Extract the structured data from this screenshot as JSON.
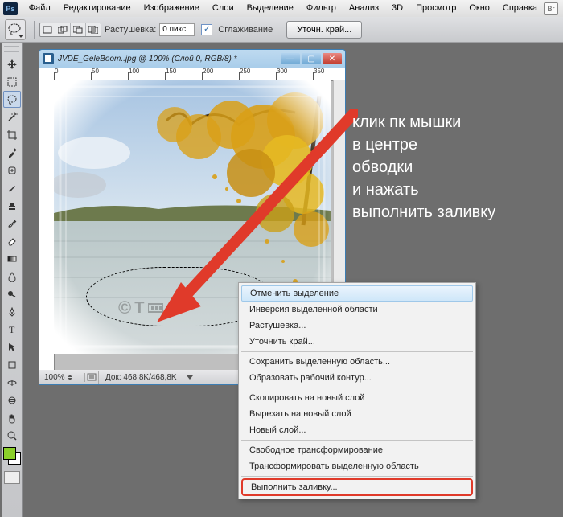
{
  "menu": {
    "items": [
      "Файл",
      "Редактирование",
      "Изображение",
      "Слои",
      "Выделение",
      "Фильтр",
      "Анализ",
      "3D",
      "Просмотр",
      "Окно",
      "Справка"
    ],
    "launch": "Br"
  },
  "options": {
    "feather_label": "Растушевка:",
    "feather_value": "0 пикс.",
    "aa_label": "Сглаживание",
    "refine_btn": "Уточн. край..."
  },
  "doc": {
    "title": "JVDE_GeleBoom..jpg @ 100% (Слой 0, RGB/8) *",
    "ruler_ticks": [
      "0",
      "50",
      "100",
      "150",
      "200",
      "250",
      "300",
      "350"
    ],
    "status_zoom": "100%",
    "status_doc": "Док: 468,8K/468,8K",
    "watermark": "© T"
  },
  "context_menu": {
    "items": [
      "Отменить выделение",
      "Инверсия выделенной области",
      "Растушевка...",
      "Уточнить край...",
      "—",
      "Сохранить выделенную область...",
      "Образовать рабочий контур...",
      "—",
      "Скопировать на новый слой",
      "Вырезать на новый слой",
      "Новый слой...",
      "—",
      "Свободное трансформирование",
      "Трансформировать выделенную область",
      "—",
      "Выполнить заливку..."
    ],
    "highlighted_index": 0,
    "outlined_index": 15
  },
  "annotation": {
    "l1": "клик пк мышки",
    "l2": "в центре",
    "l3": "обводки",
    "l4": "и нажать",
    "l5": "выполнить заливку"
  },
  "tool_names": [
    "move",
    "marquee",
    "lasso",
    "wand",
    "crop",
    "eyedropper",
    "healing",
    "brush",
    "stamp",
    "history-brush",
    "eraser",
    "gradient",
    "blur",
    "dodge",
    "pen",
    "type",
    "path-select",
    "shape",
    "3d-rotate",
    "3d-orbit",
    "hand",
    "zoom"
  ]
}
